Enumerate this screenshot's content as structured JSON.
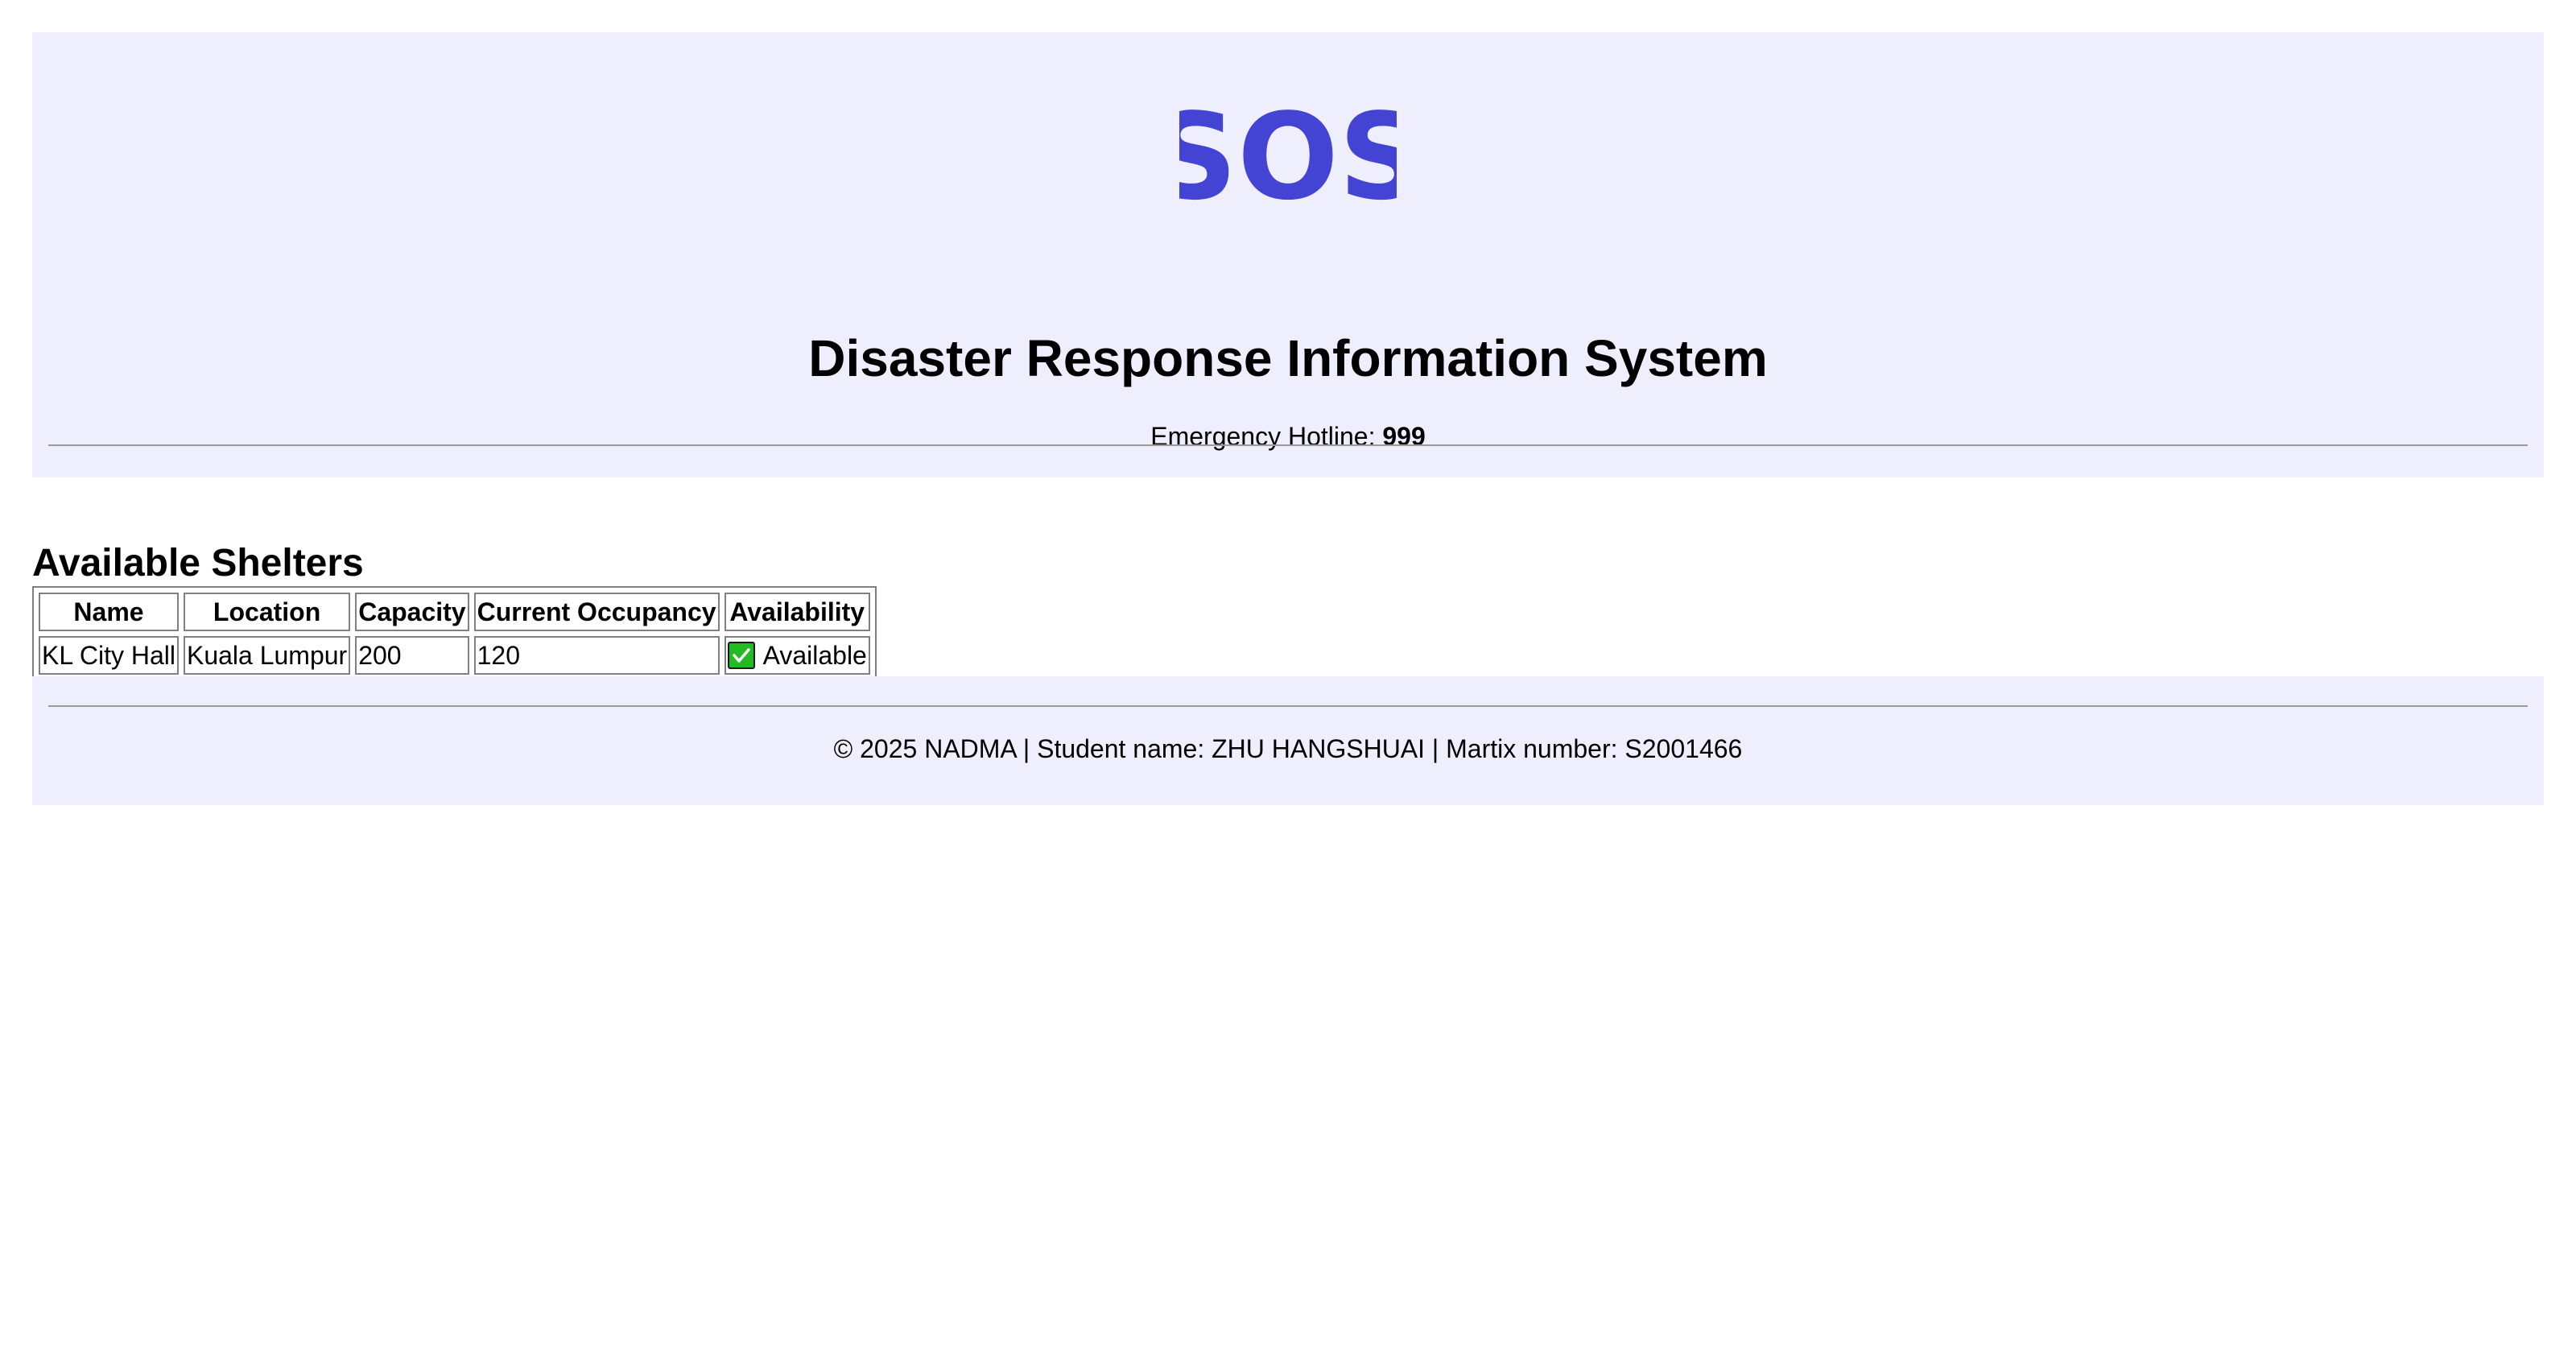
{
  "header": {
    "logo_text": "SOS",
    "title": "Disaster Response Information System",
    "hotline_label": "Emergency Hotline: ",
    "hotline_number": "999"
  },
  "shelters": {
    "title": "Available Shelters",
    "columns": [
      "Name",
      "Location",
      "Capacity",
      "Current Occupancy",
      "Availability"
    ],
    "rows": [
      {
        "name": "KL City Hall",
        "location": "Kuala Lumpur",
        "capacity": "200",
        "occupancy": "120",
        "availability": "Available",
        "availability_icon": "check-mark-icon"
      }
    ]
  },
  "footer": {
    "text": "© 2025 NADMA | Student name: ZHU HANGSHUAI | Martix number: S2001466"
  },
  "colors": {
    "header_bg": "#eeeefc",
    "logo": "#4444d4",
    "available": "#22bb22"
  }
}
